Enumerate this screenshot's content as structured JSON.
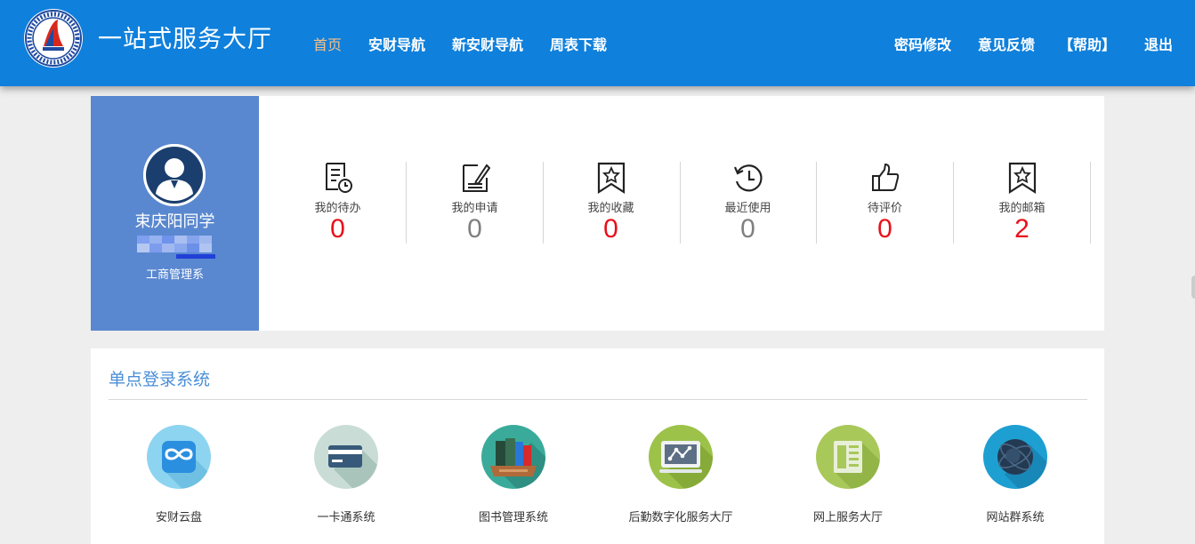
{
  "header": {
    "title": "一站式服务大厅",
    "nav_left": [
      "首页",
      "安财导航",
      "新安财导航",
      "周表下载"
    ],
    "nav_right": [
      "密码修改",
      "意见反馈",
      "【帮助】",
      "退出"
    ],
    "active_nav": "首页",
    "colors": {
      "bar": "#0f80dc",
      "active": "#f7c08a"
    }
  },
  "profile": {
    "name": "束庆阳同学",
    "department": "工商管理系",
    "icon": "user-avatar-icon"
  },
  "stats": [
    {
      "label": "我的待办",
      "count": "0",
      "icon": "todo-clock-icon",
      "color": "red"
    },
    {
      "label": "我的申请",
      "count": "0",
      "icon": "edit-document-icon",
      "color": "gray"
    },
    {
      "label": "我的收藏",
      "count": "0",
      "icon": "bookmark-star-icon",
      "color": "red"
    },
    {
      "label": "最近使用",
      "count": "0",
      "icon": "history-clock-icon",
      "color": "gray"
    },
    {
      "label": "待评价",
      "count": "0",
      "icon": "thumbs-up-icon",
      "color": "red"
    },
    {
      "label": "我的邮箱",
      "count": "2",
      "icon": "bookmark-star-icon",
      "color": "red"
    }
  ],
  "sso": {
    "title": "单点登录系统",
    "apps": [
      {
        "label": "安财云盘",
        "icon": "cloud-drive-icon",
        "color": "#8dd4f0"
      },
      {
        "label": "一卡通系统",
        "icon": "card-icon",
        "color": "#c9ddd6"
      },
      {
        "label": "图书管理系统",
        "icon": "books-icon",
        "color": "#3aab9b"
      },
      {
        "label": "后勤数字化服务大厅",
        "icon": "monitor-chart-icon",
        "color": "#9cc24a"
      },
      {
        "label": "网上服务大厅",
        "icon": "newspaper-icon",
        "color": "#a9c85a"
      },
      {
        "label": "网站群系统",
        "icon": "globe-icon",
        "color": "#1e9fd2"
      }
    ]
  }
}
